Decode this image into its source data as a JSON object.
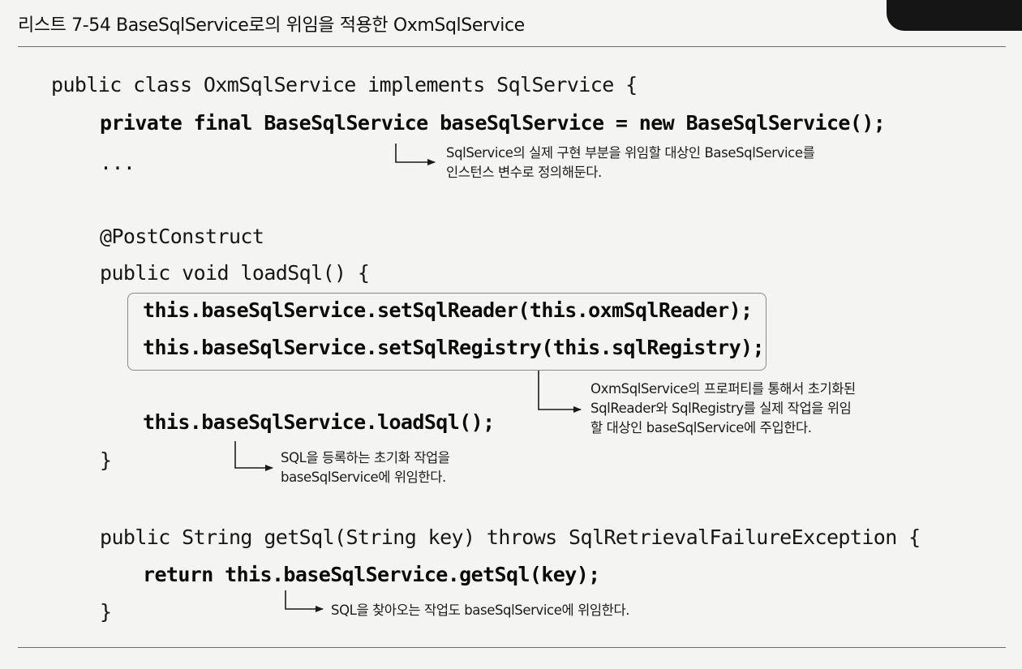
{
  "title": "리스트 7-54 BaseSqlService로의 위임을 적용한 OxmSqlService",
  "code": {
    "line1": "public class OxmSqlService implements SqlService {",
    "line2": "private final BaseSqlService baseSqlService = new BaseSqlService();",
    "line3": "...",
    "line4": "@PostConstruct",
    "line5": "public void loadSql() {",
    "line6": "this.baseSqlService.setSqlReader(this.oxmSqlReader);",
    "line7": "this.baseSqlService.setSqlRegistry(this.sqlRegistry);",
    "line8": "this.baseSqlService.loadSql();",
    "line9": "}",
    "line10": "public String getSql(String key) throws SqlRetrievalFailureException {",
    "line11": "return this.baseSqlService.getSql(key);",
    "line12": "}"
  },
  "annotations": {
    "field_note": {
      "line1": "SqlService의 실제 구현 부분을 위임할 대상인 BaseSqlService를",
      "line2": "인스턴스 변수로 정의해둔다."
    },
    "setter_note": {
      "line1": "OxmSqlService의 프로퍼티를 통해서 초기화된",
      "line2": "SqlReader와 SqlRegistry를 실제 작업을 위임",
      "line3": "할 대상인 baseSqlService에 주입한다."
    },
    "load_note": {
      "line1": "SQL을 등록하는 초기화 작업을",
      "line2": "baseSqlService에 위임한다."
    },
    "get_note": {
      "line1": "SQL을 찾아오는 작업도 baseSqlService에 위임한다."
    }
  }
}
